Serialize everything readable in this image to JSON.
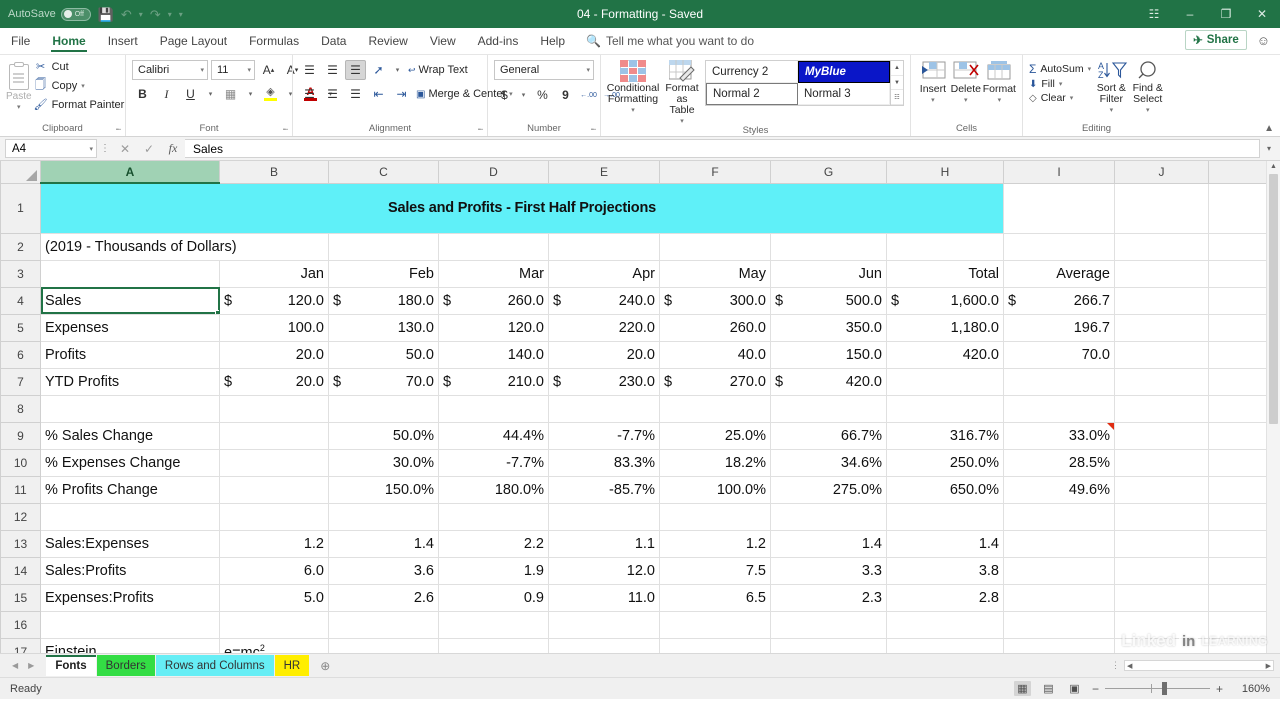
{
  "titlebar": {
    "autosave_label": "AutoSave",
    "autosave_state": "Off",
    "save_icon": "save-icon",
    "undo_icon": "undo-icon",
    "redo_icon": "redo-icon",
    "customize_icon": "chevron-down-icon",
    "document_title": "04 - Formatting  -  Saved",
    "ribbon_display_icon": "ribbon-display-options-icon",
    "minimize_icon": "minimize-icon",
    "restore_icon": "restore-icon",
    "close_icon": "close-icon"
  },
  "ribbon_tabs": [
    {
      "label": "File",
      "active": false
    },
    {
      "label": "Home",
      "active": true
    },
    {
      "label": "Insert",
      "active": false
    },
    {
      "label": "Page Layout",
      "active": false
    },
    {
      "label": "Formulas",
      "active": false
    },
    {
      "label": "Data",
      "active": false
    },
    {
      "label": "Review",
      "active": false
    },
    {
      "label": "View",
      "active": false
    },
    {
      "label": "Add-ins",
      "active": false
    },
    {
      "label": "Help",
      "active": false
    }
  ],
  "tellme": {
    "label": "Tell me what you want to do",
    "icon": "search-icon"
  },
  "share": {
    "label": "Share",
    "icon": "share-icon"
  },
  "emoji_feedback": {
    "icon": "smiley-feedback-icon"
  },
  "ribbon": {
    "clipboard": {
      "group_label": "Clipboard",
      "paste_label": "Paste",
      "cut_label": "Cut",
      "copy_label": "Copy",
      "format_painter_label": "Format Painter"
    },
    "font": {
      "group_label": "Font",
      "font_name": "Calibri",
      "font_size": "11",
      "grow_font": "A",
      "shrink_font": "A",
      "bold": "B",
      "italic": "I",
      "underline": "U"
    },
    "alignment": {
      "group_label": "Alignment",
      "wrap_text_label": "Wrap Text",
      "merge_center_label": "Merge & Center"
    },
    "number": {
      "group_label": "Number",
      "format": "General",
      "currency": "$",
      "percent": "%",
      "comma": "9",
      "increase_decimal": ".00",
      "decrease_decimal": ".00"
    },
    "styles": {
      "group_label": "Styles",
      "conditional_formatting_label": "Conditional Formatting",
      "format_as_table_label": "Format as Table",
      "gallery": [
        {
          "name": "Currency 2",
          "state": "normal"
        },
        {
          "name": "MyBlue",
          "state": "highlighted"
        },
        {
          "name": "Normal 2",
          "state": "selected"
        },
        {
          "name": "Normal 3",
          "state": "normal"
        }
      ]
    },
    "cells": {
      "group_label": "Cells",
      "insert_label": "Insert",
      "delete_label": "Delete",
      "format_label": "Format"
    },
    "editing": {
      "group_label": "Editing",
      "autosum_label": "AutoSum",
      "fill_label": "Fill",
      "clear_label": "Clear",
      "sort_filter_label": "Sort & Filter",
      "find_select_label": "Find & Select"
    },
    "collapse_icon": "chevron-up-icon"
  },
  "formula_bar": {
    "name_box": "A4",
    "cancel_icon": "cancel-icon",
    "enter_icon": "check-icon",
    "function_icon": "fx-icon",
    "content": "Sales",
    "expand_icon": "chevron-down-icon"
  },
  "grid": {
    "columns": [
      "A",
      "B",
      "C",
      "D",
      "E",
      "F",
      "G",
      "H",
      "I",
      "J"
    ],
    "selected_column": "A",
    "rows": [
      "1",
      "2",
      "3",
      "4",
      "5",
      "6",
      "7",
      "8",
      "9",
      "10",
      "11",
      "12",
      "13",
      "14",
      "15",
      "16",
      "17"
    ],
    "title_cell": "Sales and Profits - First Half Projections",
    "subtitle_cell": "(2019 - Thousands of Dollars)",
    "headers": [
      "",
      "",
      "Jan",
      "Feb",
      "Mar",
      "Apr",
      "May",
      "Jun",
      "Total",
      "Average"
    ],
    "active_cell": "A4",
    "comment_cell": "I9",
    "data_rows": [
      {
        "row": "4",
        "label": "Sales",
        "cells": [
          {
            "cur": "$",
            "v": "120.0"
          },
          {
            "cur": "$",
            "v": "180.0"
          },
          {
            "cur": "$",
            "v": "260.0"
          },
          {
            "cur": "$",
            "v": "240.0"
          },
          {
            "cur": "$",
            "v": "300.0"
          },
          {
            "cur": "$",
            "v": "500.0"
          },
          {
            "cur": "$",
            "v": "1,600.0"
          },
          {
            "cur": "$",
            "v": "266.7"
          }
        ]
      },
      {
        "row": "5",
        "label": "Expenses",
        "cells": [
          {
            "cur": "",
            "v": "100.0"
          },
          {
            "cur": "",
            "v": "130.0"
          },
          {
            "cur": "",
            "v": "120.0"
          },
          {
            "cur": "",
            "v": "220.0"
          },
          {
            "cur": "",
            "v": "260.0"
          },
          {
            "cur": "",
            "v": "350.0"
          },
          {
            "cur": "",
            "v": "1,180.0"
          },
          {
            "cur": "",
            "v": "196.7"
          }
        ]
      },
      {
        "row": "6",
        "label": "Profits",
        "cells": [
          {
            "cur": "",
            "v": "20.0"
          },
          {
            "cur": "",
            "v": "50.0"
          },
          {
            "cur": "",
            "v": "140.0"
          },
          {
            "cur": "",
            "v": "20.0"
          },
          {
            "cur": "",
            "v": "40.0"
          },
          {
            "cur": "",
            "v": "150.0"
          },
          {
            "cur": "",
            "v": "420.0"
          },
          {
            "cur": "",
            "v": "70.0"
          }
        ]
      },
      {
        "row": "7",
        "label": "YTD Profits",
        "cells": [
          {
            "cur": "$",
            "v": "20.0"
          },
          {
            "cur": "$",
            "v": "70.0"
          },
          {
            "cur": "$",
            "v": "210.0"
          },
          {
            "cur": "$",
            "v": "230.0"
          },
          {
            "cur": "$",
            "v": "270.0"
          },
          {
            "cur": "$",
            "v": "420.0"
          },
          {
            "cur": "",
            "v": ""
          },
          {
            "cur": "",
            "v": ""
          }
        ]
      },
      {
        "row": "8",
        "label": "",
        "cells": [
          {
            "cur": "",
            "v": ""
          },
          {
            "cur": "",
            "v": ""
          },
          {
            "cur": "",
            "v": ""
          },
          {
            "cur": "",
            "v": ""
          },
          {
            "cur": "",
            "v": ""
          },
          {
            "cur": "",
            "v": ""
          },
          {
            "cur": "",
            "v": ""
          },
          {
            "cur": "",
            "v": ""
          }
        ]
      },
      {
        "row": "9",
        "label": "% Sales Change",
        "cells": [
          {
            "cur": "",
            "v": ""
          },
          {
            "cur": "",
            "v": "50.0%"
          },
          {
            "cur": "",
            "v": "44.4%"
          },
          {
            "cur": "",
            "v": "-7.7%"
          },
          {
            "cur": "",
            "v": "25.0%"
          },
          {
            "cur": "",
            "v": "66.7%"
          },
          {
            "cur": "",
            "v": "316.7%"
          },
          {
            "cur": "",
            "v": "33.0%"
          }
        ]
      },
      {
        "row": "10",
        "label": "% Expenses Change",
        "cells": [
          {
            "cur": "",
            "v": ""
          },
          {
            "cur": "",
            "v": "30.0%"
          },
          {
            "cur": "",
            "v": "-7.7%"
          },
          {
            "cur": "",
            "v": "83.3%"
          },
          {
            "cur": "",
            "v": "18.2%"
          },
          {
            "cur": "",
            "v": "34.6%"
          },
          {
            "cur": "",
            "v": "250.0%"
          },
          {
            "cur": "",
            "v": "28.5%"
          }
        ]
      },
      {
        "row": "11",
        "label": "% Profits Change",
        "cells": [
          {
            "cur": "",
            "v": ""
          },
          {
            "cur": "",
            "v": "150.0%"
          },
          {
            "cur": "",
            "v": "180.0%"
          },
          {
            "cur": "",
            "v": "-85.7%"
          },
          {
            "cur": "",
            "v": "100.0%"
          },
          {
            "cur": "",
            "v": "275.0%"
          },
          {
            "cur": "",
            "v": "650.0%"
          },
          {
            "cur": "",
            "v": "49.6%"
          }
        ]
      },
      {
        "row": "12",
        "label": "",
        "cells": [
          {
            "cur": "",
            "v": ""
          },
          {
            "cur": "",
            "v": ""
          },
          {
            "cur": "",
            "v": ""
          },
          {
            "cur": "",
            "v": ""
          },
          {
            "cur": "",
            "v": ""
          },
          {
            "cur": "",
            "v": ""
          },
          {
            "cur": "",
            "v": ""
          },
          {
            "cur": "",
            "v": ""
          }
        ]
      },
      {
        "row": "13",
        "label": "Sales:Expenses",
        "cells": [
          {
            "cur": "",
            "v": "1.2"
          },
          {
            "cur": "",
            "v": "1.4"
          },
          {
            "cur": "",
            "v": "2.2"
          },
          {
            "cur": "",
            "v": "1.1"
          },
          {
            "cur": "",
            "v": "1.2"
          },
          {
            "cur": "",
            "v": "1.4"
          },
          {
            "cur": "",
            "v": "1.4"
          },
          {
            "cur": "",
            "v": ""
          }
        ]
      },
      {
        "row": "14",
        "label": "Sales:Profits",
        "cells": [
          {
            "cur": "",
            "v": "6.0"
          },
          {
            "cur": "",
            "v": "3.6"
          },
          {
            "cur": "",
            "v": "1.9"
          },
          {
            "cur": "",
            "v": "12.0"
          },
          {
            "cur": "",
            "v": "7.5"
          },
          {
            "cur": "",
            "v": "3.3"
          },
          {
            "cur": "",
            "v": "3.8"
          },
          {
            "cur": "",
            "v": ""
          }
        ]
      },
      {
        "row": "15",
        "label": "Expenses:Profits",
        "cells": [
          {
            "cur": "",
            "v": "5.0"
          },
          {
            "cur": "",
            "v": "2.6"
          },
          {
            "cur": "",
            "v": "0.9"
          },
          {
            "cur": "",
            "v": "11.0"
          },
          {
            "cur": "",
            "v": "6.5"
          },
          {
            "cur": "",
            "v": "2.3"
          },
          {
            "cur": "",
            "v": "2.8"
          },
          {
            "cur": "",
            "v": ""
          }
        ]
      },
      {
        "row": "16",
        "label": "",
        "cells": [
          {
            "cur": "",
            "v": ""
          },
          {
            "cur": "",
            "v": ""
          },
          {
            "cur": "",
            "v": ""
          },
          {
            "cur": "",
            "v": ""
          },
          {
            "cur": "",
            "v": ""
          },
          {
            "cur": "",
            "v": ""
          },
          {
            "cur": "",
            "v": ""
          },
          {
            "cur": "",
            "v": ""
          }
        ]
      },
      {
        "row": "17",
        "label": "Einstein",
        "einstein_base": "e=mc",
        "einstein_exp": "2",
        "cells": [
          {
            "cur": "",
            "v": ""
          },
          {
            "cur": "",
            "v": ""
          },
          {
            "cur": "",
            "v": ""
          },
          {
            "cur": "",
            "v": ""
          },
          {
            "cur": "",
            "v": ""
          },
          {
            "cur": "",
            "v": ""
          },
          {
            "cur": "",
            "v": ""
          },
          {
            "cur": "",
            "v": ""
          }
        ]
      }
    ]
  },
  "sheet_tabs": {
    "prev_icon": "chevron-left-icon",
    "next_icon": "chevron-right-icon",
    "add_icon": "plus-circle-icon",
    "tabs": [
      {
        "label": "Fonts",
        "color": "#ffff99",
        "active": true
      },
      {
        "label": "Borders",
        "color": "#33dd44",
        "active": false
      },
      {
        "label": "Rows and Columns",
        "color": "#66eef5",
        "active": false
      },
      {
        "label": "HR",
        "color": "#ffee00",
        "active": false
      }
    ]
  },
  "statusbar": {
    "status": "Ready",
    "view_normal_icon": "normal-view-icon",
    "view_pagelayout_icon": "page-layout-view-icon",
    "view_pagebreak_icon": "page-break-view-icon",
    "zoom_out_icon": "minus-icon",
    "zoom_in_icon": "plus-icon",
    "zoom_level": "160%"
  },
  "watermark": {
    "word1": "Linked",
    "word2": "in",
    "word3": "LEARNING"
  },
  "colors": {
    "excel_green": "#217346",
    "title_fill": "#5ff0f8",
    "myblue_style": "#0a16c8",
    "selected_header": "#a0d2b4",
    "comment_marker": "#e02d12"
  }
}
